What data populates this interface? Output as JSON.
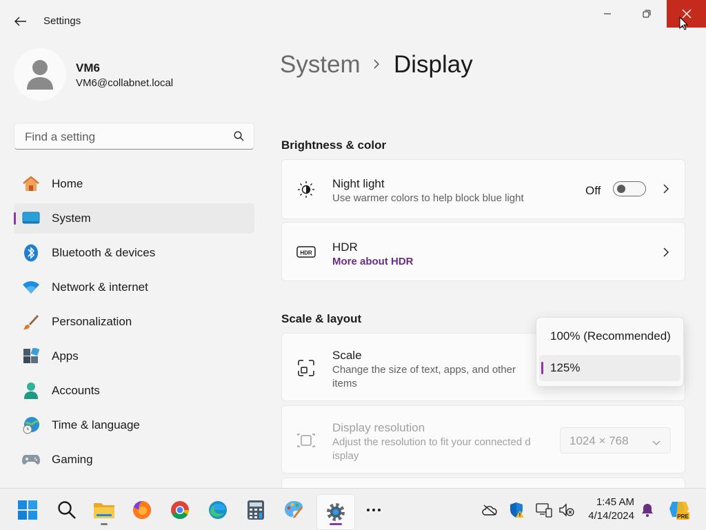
{
  "window": {
    "title": "Settings",
    "controls": {
      "minimize": "minimize-icon",
      "restore": "restore-icon",
      "close": "close-icon"
    },
    "close_color": "#c42b1c"
  },
  "user": {
    "name": "VM6",
    "email": "VM6@collabnet.local"
  },
  "search": {
    "placeholder": "Find a setting",
    "value": ""
  },
  "sidebar": {
    "items": [
      {
        "label": "Home",
        "icon": "home-icon",
        "selected": false
      },
      {
        "label": "System",
        "icon": "system-icon",
        "selected": true
      },
      {
        "label": "Bluetooth & devices",
        "icon": "bluetooth-icon",
        "selected": false
      },
      {
        "label": "Network & internet",
        "icon": "wifi-icon",
        "selected": false
      },
      {
        "label": "Personalization",
        "icon": "brush-icon",
        "selected": false
      },
      {
        "label": "Apps",
        "icon": "apps-icon",
        "selected": false
      },
      {
        "label": "Accounts",
        "icon": "accounts-icon",
        "selected": false
      },
      {
        "label": "Time & language",
        "icon": "time-language-icon",
        "selected": false
      },
      {
        "label": "Gaming",
        "icon": "gamepad-icon",
        "selected": false
      }
    ],
    "accent": "#8a3a9e"
  },
  "breadcrumb": {
    "parent": "System",
    "current": "Display"
  },
  "sections": {
    "brightness": {
      "heading": "Brightness & color",
      "night_light": {
        "title": "Night light",
        "subtitle": "Use warmer colors to help block blue light",
        "state_label": "Off",
        "on": false
      },
      "hdr": {
        "title": "HDR",
        "link": "More about HDR"
      }
    },
    "scale_layout": {
      "heading": "Scale & layout",
      "scale": {
        "title": "Scale",
        "subtitle_line1": "Change the size of text, apps, and other",
        "subtitle_line2": "items"
      },
      "resolution": {
        "title": "Display resolution",
        "subtitle_line1": "Adjust the resolution to fit your connected d",
        "subtitle_line2": "isplay",
        "value": "1024 × 768",
        "disabled": true
      }
    }
  },
  "scale_popup": {
    "options": [
      {
        "label": "100% (Recommended)",
        "selected": false
      },
      {
        "label": "125%",
        "selected": true
      }
    ]
  },
  "taskbar": {
    "apps": [
      "start-icon",
      "search-icon",
      "file-explorer-icon",
      "firefox-icon",
      "chrome-icon",
      "edge-icon",
      "calculator-icon",
      "paint-icon",
      "settings-icon",
      "more-icon"
    ],
    "tray": [
      "onedrive-icon",
      "defender-icon",
      "network-icon",
      "volume-muted-icon"
    ],
    "time": "1:45 AM",
    "date": "4/14/2024",
    "pre_badge": "PRE"
  }
}
